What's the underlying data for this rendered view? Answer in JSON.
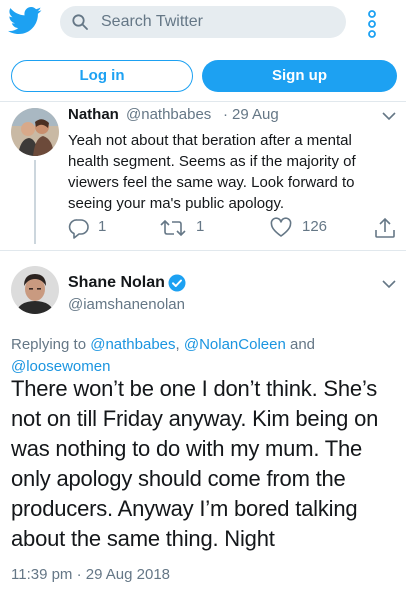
{
  "header": {
    "search_placeholder": "Search Twitter",
    "login_label": "Log in",
    "signup_label": "Sign up"
  },
  "icons": {
    "logo": "twitter-bird-icon",
    "search": "search-icon",
    "more": "more-vertical-icon"
  },
  "colors": {
    "accent": "#1da1f2",
    "secondary_text": "#657786",
    "link": "#1b95e0",
    "search_bg": "#e6ecf0"
  },
  "reply_tweet": {
    "name": "Nathan",
    "handle": "@nathbabes",
    "separator": "·",
    "date": "29 Aug",
    "text": "Yeah not about that beration after a mental health segment. Seems as if the majority of viewers feel the same way. Look forward to seeing your ma's public apology.",
    "replies": "1",
    "retweets": "1",
    "likes": "126"
  },
  "main_tweet": {
    "name": "Shane Nolan",
    "handle": "@iamshanenolan",
    "replying_prefix": "Replying to ",
    "mention_1": "@nathbabes",
    "mention_sep": ", ",
    "mention_2": "@NolanColeen",
    "mention_and": " and ",
    "mention_3": "@loosewomen",
    "text": "There won’t be one I don’t think. She’s not on till Friday anyway. Kim being on was nothing to do with my mum. The only apology should come from the producers. Anyway I’m bored talking about the same thing. Night",
    "timestamp": "11:39 pm · 29 Aug 2018"
  }
}
